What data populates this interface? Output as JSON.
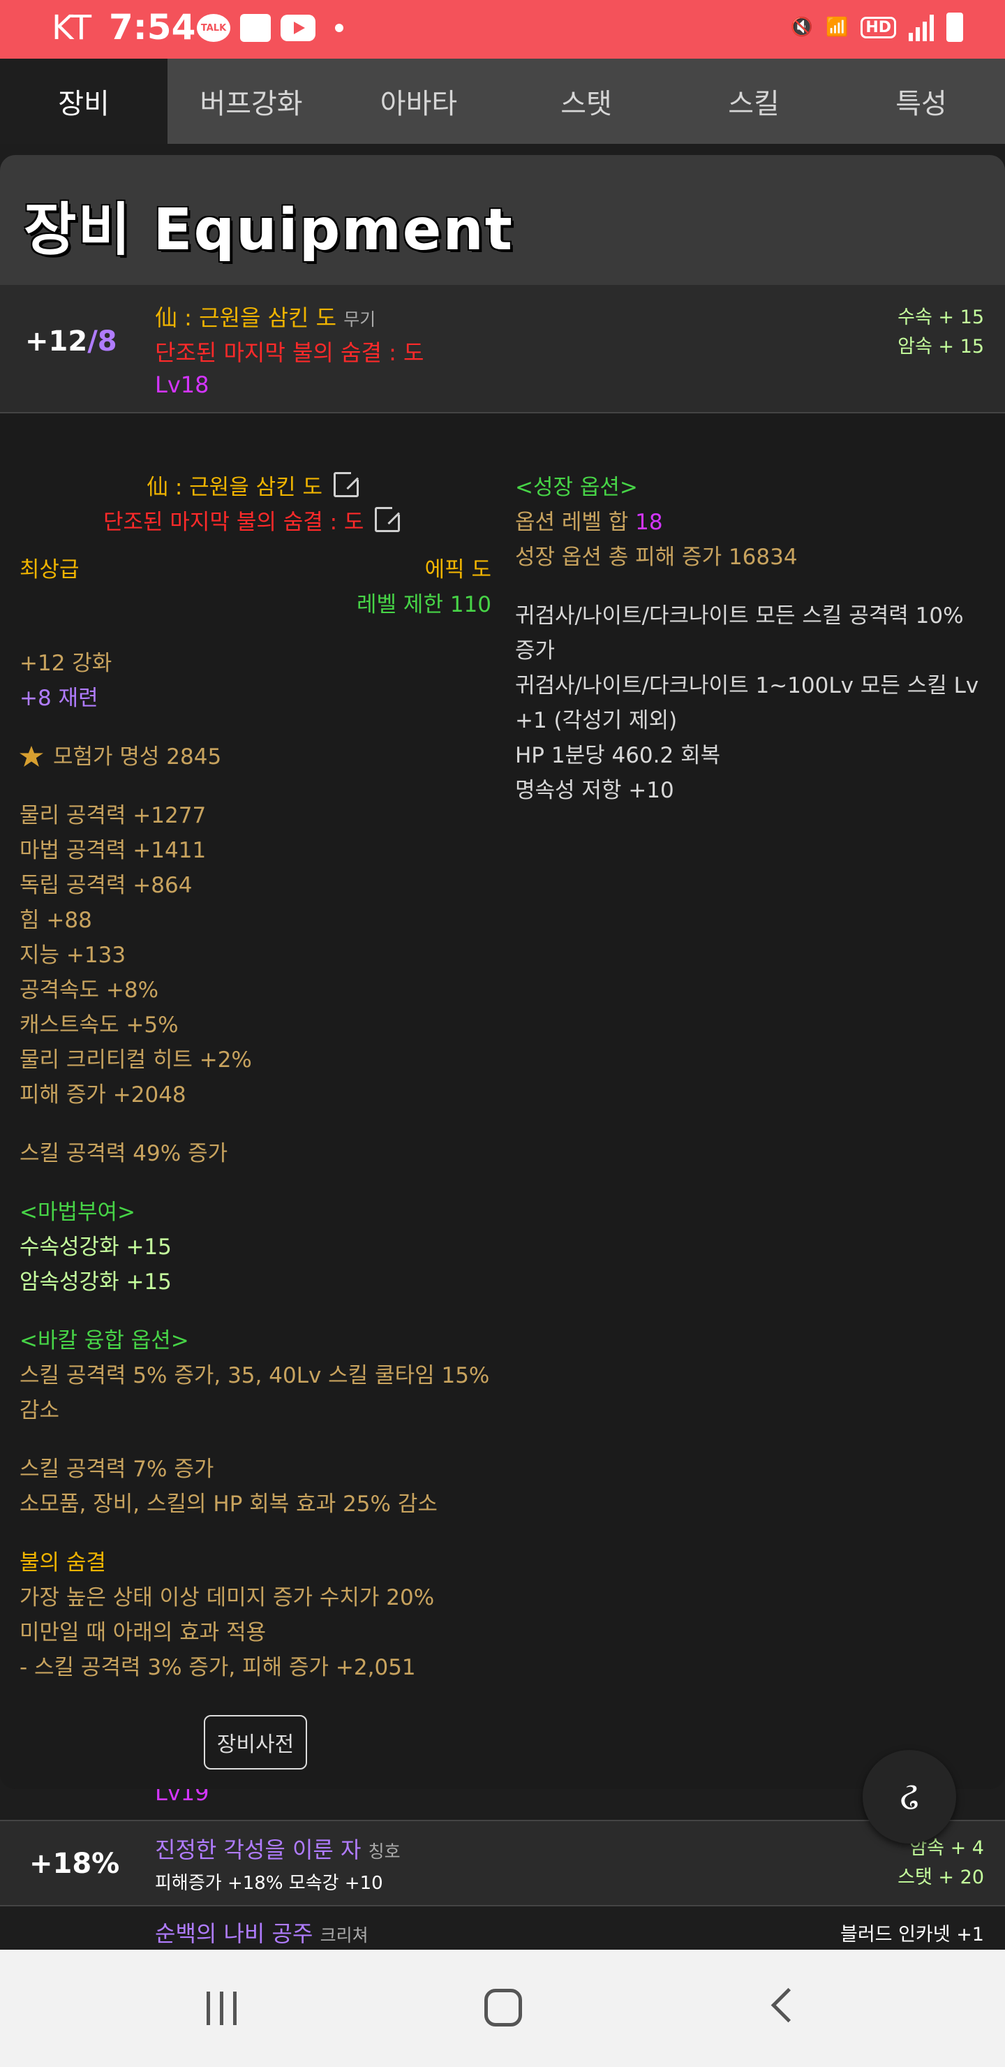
{
  "status_bar": {
    "carrier": "KT",
    "time": "7:54",
    "talk": "TALK",
    "hd": "HD"
  },
  "tabs": [
    "장비",
    "버프강화",
    "아바타",
    "스탯",
    "스킬",
    "특성"
  ],
  "card": {
    "title": "장비 Equipment",
    "item": {
      "level": "+12",
      "level_of": "/8",
      "name": "仙 : 근원을 삼킨 도",
      "type": "무기",
      "set_name": "단조된 마지막 불의 숨결 : 도",
      "lv": "Lv18",
      "elem1": "수속 + 15",
      "elem2": "암속 + 15"
    },
    "detail": {
      "name": "仙 : 근원을 삼킨 도",
      "set_name": "단조된 마지막 불의 숨결 : 도",
      "grade": "최상급",
      "rarity": "에픽 도",
      "level_limit": "레벨 제한 110",
      "reinforce": "+12 강화",
      "refine": "+8 재련",
      "fame": "모험가 명성 2845",
      "stats": [
        "물리 공격력 +1277",
        "마법 공격력 +1411",
        "독립 공격력 +864",
        "힘 +88",
        "지능 +133",
        "공격속도 +8%",
        "캐스트속도 +5%",
        "물리 크리티컬 히트 +2%",
        "피해 증가 +2048"
      ],
      "skill_attack": "스킬 공격력 49% 증가",
      "enchant_header": "<마법부여>",
      "enchant": [
        "수속성강화 +15",
        "암속성강화 +15"
      ],
      "bakal_header": "<바칼 융합 옵션>",
      "bakal": [
        "스킬 공격력 5% 증가, 35, 40Lv 스킬 쿨타임 15%",
        "감소"
      ],
      "extra": [
        "스킬 공격력 7% 증가",
        "소모품, 장비, 스킬의 HP 회복 효과 25% 감소"
      ],
      "fire_title": "불의 숨결",
      "fire": [
        "가장 높은 상태 이상 데미지 증가 수치가 20%",
        "미만일 때 아래의 효과 적용",
        "- 스킬 공격력 3% 증가, 피해 증가 +2,051"
      ],
      "growth_header": "<성장 옵션>",
      "growth_level_label": "옵션 레벨 합",
      "growth_level_value": "18",
      "growth_damage": "성장 옵션 총 피해 증가 16834",
      "growth_lines": [
        "귀검사/나이트/다크나이트 모든 스킬 공격력 10%",
        "증가",
        "귀검사/나이트/다크나이트 1~100Lv 모든 스킬 Lv",
        "+1 (각성기 제외)",
        "HP 1분당 460.2 회복",
        "명속성 저항 +10"
      ]
    },
    "dict_button": "장비사전"
  },
  "list": {
    "lv": "Lv19",
    "row2": {
      "value": "+18%",
      "name": "진정한 각성을 이룬 자",
      "type": "칭호",
      "sub": "피해증가 +18% 모속강 +10",
      "right1": "암속 + 4",
      "right2": "스탯 + 20"
    },
    "row3": {
      "name": "순백의 나비 공주",
      "type": "크리쳐",
      "right": "블러드 인카넷 +1"
    }
  }
}
